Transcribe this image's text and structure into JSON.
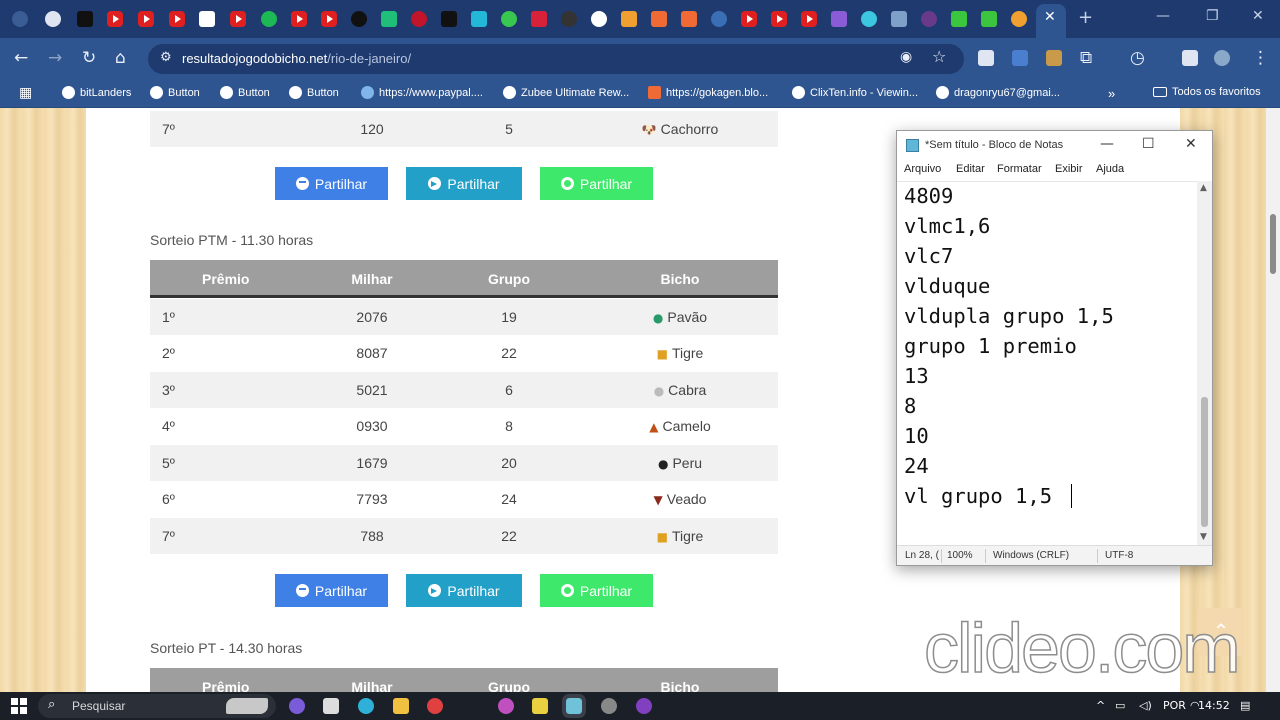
{
  "browser": {
    "url_host": "resultadojogodobicho.net",
    "url_path": "/rio-de-janeiro/",
    "bookmarks": [
      "bitLanders",
      "Button",
      "Button",
      "Button",
      "https://www.paypal....",
      "Zubee Ultimate Rew...",
      "https://gokagen.blo...",
      "ClixTen.info - Viewin...",
      "dragonryu67@gmai...",
      "Todos os favoritos"
    ]
  },
  "page": {
    "prev_row": {
      "premio": "7º",
      "milhar": "120",
      "grupo": "5",
      "bicho": "Cachorro"
    },
    "share_labels": {
      "facebook": "Partilhar",
      "telegram": "Partilhar",
      "whatsapp": "Partilhar"
    },
    "ptm": {
      "title": "Sorteio PTM - 11.30 horas",
      "headers": [
        "Prêmio",
        "Milhar",
        "Grupo",
        "Bicho"
      ],
      "rows": [
        {
          "premio": "1º",
          "milhar": "2076",
          "grupo": "19",
          "bicho": "Pavão"
        },
        {
          "premio": "2º",
          "milhar": "8087",
          "grupo": "22",
          "bicho": "Tigre"
        },
        {
          "premio": "3º",
          "milhar": "5021",
          "grupo": "6",
          "bicho": "Cabra"
        },
        {
          "premio": "4º",
          "milhar": "0930",
          "grupo": "8",
          "bicho": "Camelo"
        },
        {
          "premio": "5º",
          "milhar": "1679",
          "grupo": "20",
          "bicho": "Peru"
        },
        {
          "premio": "6º",
          "milhar": "7793",
          "grupo": "24",
          "bicho": "Veado"
        },
        {
          "premio": "7º",
          "milhar": "788",
          "grupo": "22",
          "bicho": "Tigre"
        }
      ]
    },
    "pt": {
      "title": "Sorteio PT - 14.30 horas",
      "headers": [
        "Prêmio",
        "Milhar",
        "Grupo",
        "Bicho"
      ]
    }
  },
  "notepad": {
    "title": "*Sem título - Bloco de Notas",
    "menu": [
      "Arquivo",
      "Editar",
      "Formatar",
      "Exibir",
      "Ajuda"
    ],
    "lines": [
      "4809",
      "vlmc1,6",
      "vlc7",
      "vlduque",
      "vldupla grupo 1,5",
      "grupo 1 premio",
      "13",
      "8",
      "10",
      "24",
      "vl grupo 1,5"
    ],
    "status": {
      "position": "Ln 28, (",
      "zoom": "100%",
      "eol": "Windows (CRLF)",
      "encoding": "UTF-8"
    }
  },
  "watermark": "clideo.com",
  "taskbar": {
    "search_placeholder": "Pesquisar",
    "language": "POR",
    "time": "14:52"
  }
}
